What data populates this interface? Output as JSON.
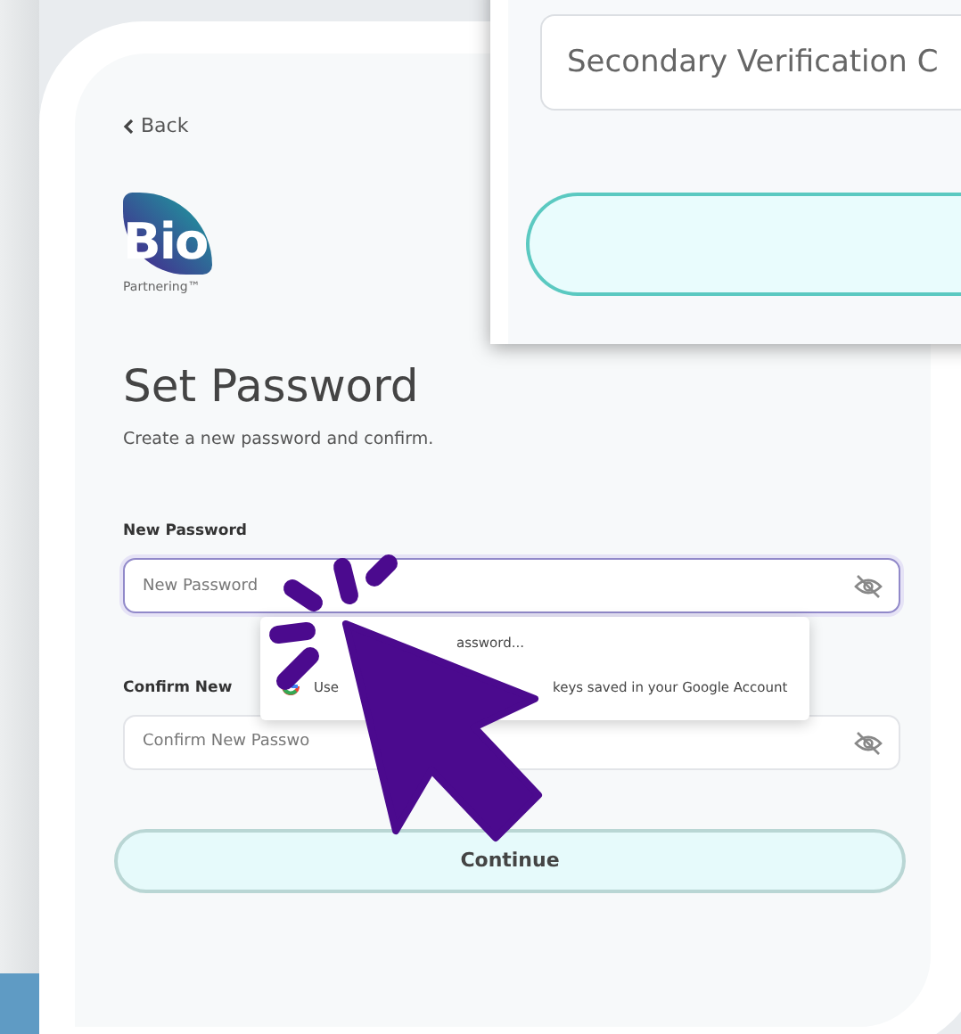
{
  "back_link": "Back",
  "logo": {
    "name": "Bio",
    "tagline": "Partnering™"
  },
  "title": "Set Password",
  "subtitle": "Create a new password and confirm.",
  "fields": [
    {
      "label": "New Password",
      "placeholder": "New Password",
      "focused": true
    },
    {
      "label": "Confirm New",
      "placeholder": "Confirm New Passwo",
      "focused": false
    }
  ],
  "autofill_popup": {
    "heading": "assword...",
    "lines": [
      "Use",
      "keys saved in your Google Account"
    ]
  },
  "continue_button": "Continue",
  "background_card": {
    "field_placeholder": "Secondary Verification C"
  }
}
